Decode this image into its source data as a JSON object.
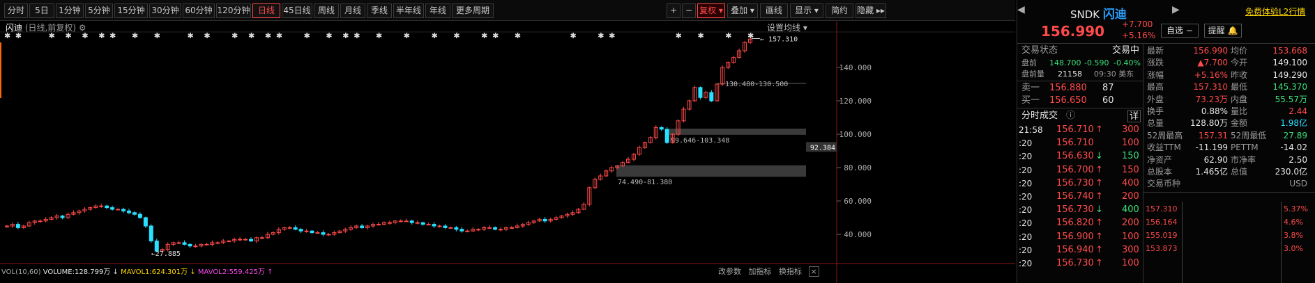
{
  "toolbar": {
    "periods": [
      "分时",
      "5日",
      "1分钟",
      "5分钟",
      "15分钟",
      "30分钟",
      "60分钟",
      "120分钟",
      "日线",
      "45日线",
      "周线",
      "月线",
      "季线",
      "半年线",
      "年线",
      "更多周期"
    ],
    "active_period": "日线",
    "right_tools": {
      "plus": "+",
      "minus": "−",
      "restore": "复权",
      "overlay": "叠加",
      "draw": "画线",
      "display": "显示",
      "simplified": "简约",
      "hide": "隐藏"
    }
  },
  "chart": {
    "stock_name": "闪迪",
    "mode": "(日线,前复权)",
    "settings_label": "设置均线",
    "price_labels": [
      "140.000",
      "120.000",
      "100.000",
      "80.000",
      "60.000",
      "40.000"
    ],
    "current_price_tag": "92.384",
    "annotations": {
      "high": "157.310",
      "low": "27.885",
      "zone1": "130.480-130.500",
      "zone2": "99.646-103.348",
      "zone3": "74.490-81.380"
    },
    "volume_bar": {
      "label": "VOL(10,60)",
      "volume": "VOLUME:128.799万",
      "ma1": "MAVOL1:624.301万",
      "ma2": "MAVOL2:559.425万"
    },
    "bottom_buttons": {
      "params": "改参数",
      "add_indicator": "加指标",
      "change_indicator": "换指标"
    }
  },
  "chart_data": {
    "type": "candlestick",
    "y_range": [
      30,
      160
    ],
    "y_ticks": [
      140,
      120,
      100,
      80,
      60,
      40
    ],
    "closes": [
      45,
      46,
      44,
      45,
      47,
      48,
      48,
      49,
      50,
      51,
      50,
      52,
      53,
      54,
      55,
      56,
      57,
      57,
      56,
      55,
      55,
      54,
      53,
      52,
      50,
      45,
      36,
      30,
      31,
      34,
      35,
      35,
      34,
      33,
      33,
      34,
      34,
      35,
      35,
      36,
      36,
      37,
      37,
      37,
      36,
      38,
      38,
      40,
      41,
      43,
      44,
      44,
      43,
      42,
      42,
      41,
      41,
      40,
      40,
      41,
      42,
      43,
      44,
      45,
      44,
      45,
      46,
      46,
      47,
      47,
      48,
      48,
      48,
      47,
      47,
      46,
      46,
      45,
      45,
      44,
      44,
      43,
      42,
      42,
      43,
      43,
      44,
      44,
      43,
      43,
      44,
      44,
      45,
      46,
      47,
      48,
      49,
      48,
      49,
      50,
      51,
      52,
      53,
      55,
      58,
      68,
      73,
      75,
      78,
      80,
      81,
      83,
      85,
      88,
      92,
      95,
      98,
      104,
      103,
      95,
      100,
      108,
      115,
      120,
      128,
      122,
      125,
      120,
      130,
      140,
      143,
      146,
      150,
      155,
      156.99
    ],
    "high": 157.31,
    "low": 27.885
  },
  "quote": {
    "ticker": "SNDK",
    "name": "闪迪",
    "trial_link": "免费体验L2行情",
    "price": "156.990",
    "change": "+7.700",
    "change_pct": "+5.16%",
    "watchlist_btn": "自选",
    "alert_btn": "提醒",
    "trade_status_label": "交易状态",
    "trade_status": "交易中",
    "premarket": {
      "label": "盘前",
      "price": "148.700",
      "chg": "-0.590",
      "pct": "-0.40%"
    },
    "premarket_vol": {
      "label": "盘前量",
      "value": "21158",
      "time": "09:30 美东"
    },
    "ask1": {
      "label": "卖一",
      "price": "156.880",
      "vol": "87"
    },
    "bid1": {
      "label": "买一",
      "price": "156.650",
      "vol": "60"
    },
    "ticks_title": "分时成交",
    "ticks_detail": "详",
    "ticks": [
      {
        "time": "21:58",
        "price": "156.710",
        "arrow": "↑",
        "vol": "300",
        "dir": "up"
      },
      {
        "time": ":20",
        "price": "156.710",
        "arrow": "",
        "vol": "100",
        "dir": "up"
      },
      {
        "time": ":20",
        "price": "156.630",
        "arrow": "↓",
        "vol": "150",
        "dir": "down"
      },
      {
        "time": ":20",
        "price": "156.700",
        "arrow": "↑",
        "vol": "150",
        "dir": "up"
      },
      {
        "time": ":20",
        "price": "156.730",
        "arrow": "↑",
        "vol": "400",
        "dir": "up"
      },
      {
        "time": ":20",
        "price": "156.740",
        "arrow": "↑",
        "vol": "200",
        "dir": "up"
      },
      {
        "time": ":20",
        "price": "156.730",
        "arrow": "↓",
        "vol": "400",
        "dir": "down"
      },
      {
        "time": ":20",
        "price": "156.820",
        "arrow": "↑",
        "vol": "200",
        "dir": "up"
      },
      {
        "time": ":20",
        "price": "156.900",
        "arrow": "↑",
        "vol": "100",
        "dir": "up"
      },
      {
        "time": ":20",
        "price": "156.940",
        "arrow": "↑",
        "vol": "300",
        "dir": "up"
      },
      {
        "time": ":20",
        "price": "156.730",
        "arrow": "↑",
        "vol": "100",
        "dir": "up"
      }
    ],
    "stats": [
      {
        "l1": "最新",
        "v1": "156.990",
        "c1": "red",
        "l2": "均价",
        "v2": "153.668",
        "c2": "red"
      },
      {
        "l1": "涨跌",
        "v1": "▲7.700",
        "c1": "red",
        "l2": "今开",
        "v2": "149.100",
        "c2": "white"
      },
      {
        "l1": "涨幅",
        "v1": "+5.16%",
        "c1": "red",
        "l2": "昨收",
        "v2": "149.290",
        "c2": "white"
      },
      {
        "l1": "最高",
        "v1": "157.310",
        "c1": "red",
        "l2": "最低",
        "v2": "145.370",
        "c2": "green"
      },
      {
        "l1": "外盘",
        "v1": "73.23万",
        "c1": "red",
        "l2": "内盘",
        "v2": "55.57万",
        "c2": "green"
      },
      {
        "l1": "换手",
        "v1": "0.88%",
        "c1": "white",
        "l2": "量比",
        "v2": "2.44",
        "c2": "red"
      },
      {
        "l1": "总量",
        "v1": "128.80万",
        "c1": "white",
        "l2": "金额",
        "v2": "1.98亿",
        "c2": "cyan"
      },
      {
        "l1": "52周最高",
        "v1": "157.31",
        "c1": "red",
        "l2": "52周最低",
        "v2": "27.89",
        "c2": "green"
      },
      {
        "l1": "收益TTM",
        "v1": "-11.199",
        "c1": "white",
        "l2": "PETTM",
        "v2": "-14.02",
        "c2": "white"
      },
      {
        "l1": "净资产",
        "v1": "62.90",
        "c1": "white",
        "l2": "市净率",
        "v2": "2.50",
        "c2": "white"
      },
      {
        "l1": "总股本",
        "v1": "1.465亿",
        "c1": "white",
        "l2": "总值",
        "v2": "230.0亿",
        "c2": "white"
      },
      {
        "l1": "交易币种",
        "v1": "",
        "c1": "white",
        "l2": "",
        "v2": "USD",
        "c2": "gray"
      }
    ],
    "mini_chart": {
      "prices": [
        "157.310",
        "156.164",
        "155.019",
        "153.873"
      ],
      "pcts": [
        "5.37%",
        "4.6%",
        "3.8%",
        "3.0%"
      ]
    }
  },
  "colors": {
    "up": "#ff4a4a",
    "down": "#28e0ff",
    "accent": "#ff4a4a"
  }
}
